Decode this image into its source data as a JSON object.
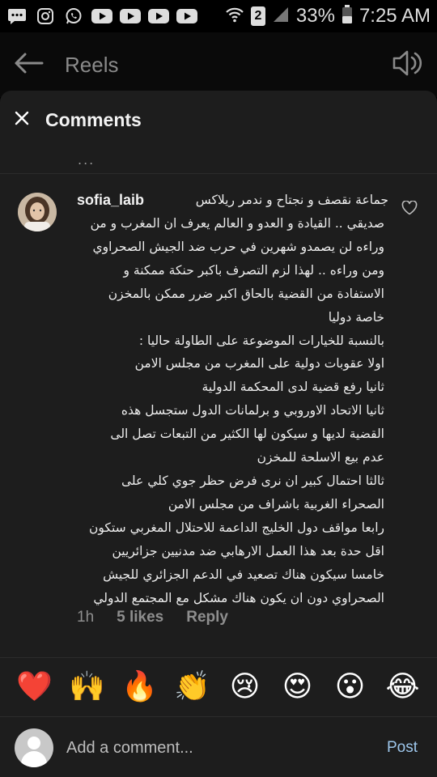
{
  "status_bar": {
    "battery_text": "33%",
    "time": "7:25 AM",
    "sim_badge": "2",
    "icons": [
      "chat-bubble-icon",
      "instagram-icon",
      "whatsapp-icon",
      "youtube-icon",
      "youtube-icon",
      "youtube-icon",
      "youtube-icon",
      "wifi-icon",
      "sim-icon",
      "signal-icon",
      "battery-icon"
    ]
  },
  "header": {
    "title": "Reels",
    "back_icon": "back-arrow-icon",
    "speaker_icon": "speaker-icon"
  },
  "sheet": {
    "title": "Comments",
    "close_icon": "close-icon",
    "prev_indicator": "..."
  },
  "comment": {
    "username": "sofia_laib",
    "lines": [
      "جماعة نقصف و نجتاح و ندمر ريلاكس",
      "صديقي .. القيادة و العدو و العالم يعرف ان المغرب و من",
      "وراءه لن يصمدو شهرين في حرب ضد الجيش الصحراوي",
      "ومن وراءه .. لهذا لزم التصرف باكبر حنكة ممكنة و",
      "الاستفادة من القضية بالحاق اكبر ضرر ممكن بالمخزن",
      "خاصة دوليا",
      "بالنسبة للخيارات الموضوعة على الطاولة حاليا :",
      "اولا عقوبات دولية على المغرب من مجلس الامن",
      "ثانيا رفع قضية لدى المحكمة الدولية",
      "ثانيا الاتحاد الاوروبي و برلمانات الدول ستجسل هذه",
      "القضية لديها و سيكون لها الكثير من التبعات تصل الى",
      "عدم بيع الاسلحة للمخزن",
      "ثالثا احتمال كبير ان نرى فرض حظر جوي كلي على",
      "الصحراء الغربية باشراف من مجلس الامن",
      "رابعا مواقف دول الخليج الداعمة للاحتلال المغربي ستكون",
      "اقل حدة بعد هذا العمل الارهابي ضد مدنيين جزائريين",
      "خامسا سيكون هناك تصعيد في الدعم الجزائري للجيش",
      "الصحراوي دون ان يكون هناك مشكل مع المجتمع الدولي"
    ],
    "time_ago": "1h",
    "likes": "5 likes",
    "reply": "Reply",
    "like_icon": "heart-outline-icon"
  },
  "emoji_bar": [
    "❤️",
    "🙌",
    "🔥",
    "👏",
    "😢",
    "😍",
    "😮",
    "😂"
  ],
  "composer": {
    "placeholder": "Add a comment...",
    "post_label": "Post"
  }
}
